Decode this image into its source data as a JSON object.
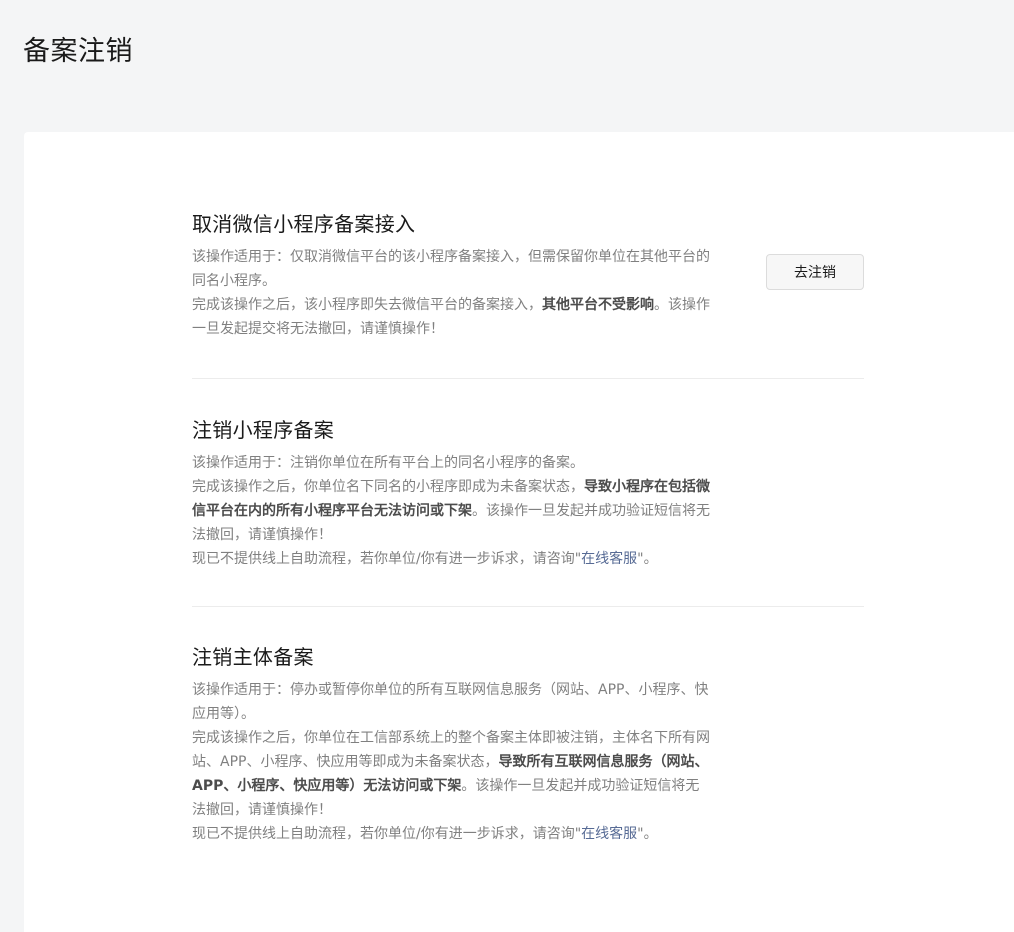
{
  "page_title": "备案注销",
  "sections": [
    {
      "title": "取消微信小程序备案接入",
      "button_label": "去注销",
      "p1": "该操作适用于：仅取消微信平台的该小程序备案接入，但需保留你单位在其他平台的同名小程序。",
      "p2_before": "完成该操作之后，该小程序即失去微信平台的备案接入，",
      "p2_bold": "其他平台不受影响",
      "p2_after": "。该操作一旦发起提交将无法撤回，请谨慎操作！"
    },
    {
      "title": "注销小程序备案",
      "p1": "该操作适用于：注销你单位在所有平台上的同名小程序的备案。",
      "p2_before": "完成该操作之后，你单位名下同名的小程序即成为未备案状态，",
      "p2_bold": "导致小程序在包括微信平台在内的所有小程序平台无法访问或下架",
      "p2_after": "。该操作一旦发起并成功验证短信将无法撤回，请谨慎操作！",
      "p3_before": "现已不提供线上自助流程，若你单位/你有进一步诉求，请咨询\"",
      "p3_link": "在线客服",
      "p3_after": "\"。"
    },
    {
      "title": "注销主体备案",
      "p1": "该操作适用于：停办或暂停你单位的所有互联网信息服务（网站、APP、小程序、快应用等）。",
      "p2_before": "完成该操作之后，你单位在工信部系统上的整个备案主体即被注销，主体名下所有网站、APP、小程序、快应用等即成为未备案状态，",
      "p2_bold": "导致所有互联网信息服务（网站、APP、小程序、快应用等）无法访问或下架",
      "p2_after": "。该操作一旦发起并成功验证短信将无法撤回，请谨慎操作！",
      "p3_before": "现已不提供线上自助流程，若你单位/你有进一步诉求，请咨询\"",
      "p3_link": "在线客服",
      "p3_after": "\"。"
    }
  ]
}
